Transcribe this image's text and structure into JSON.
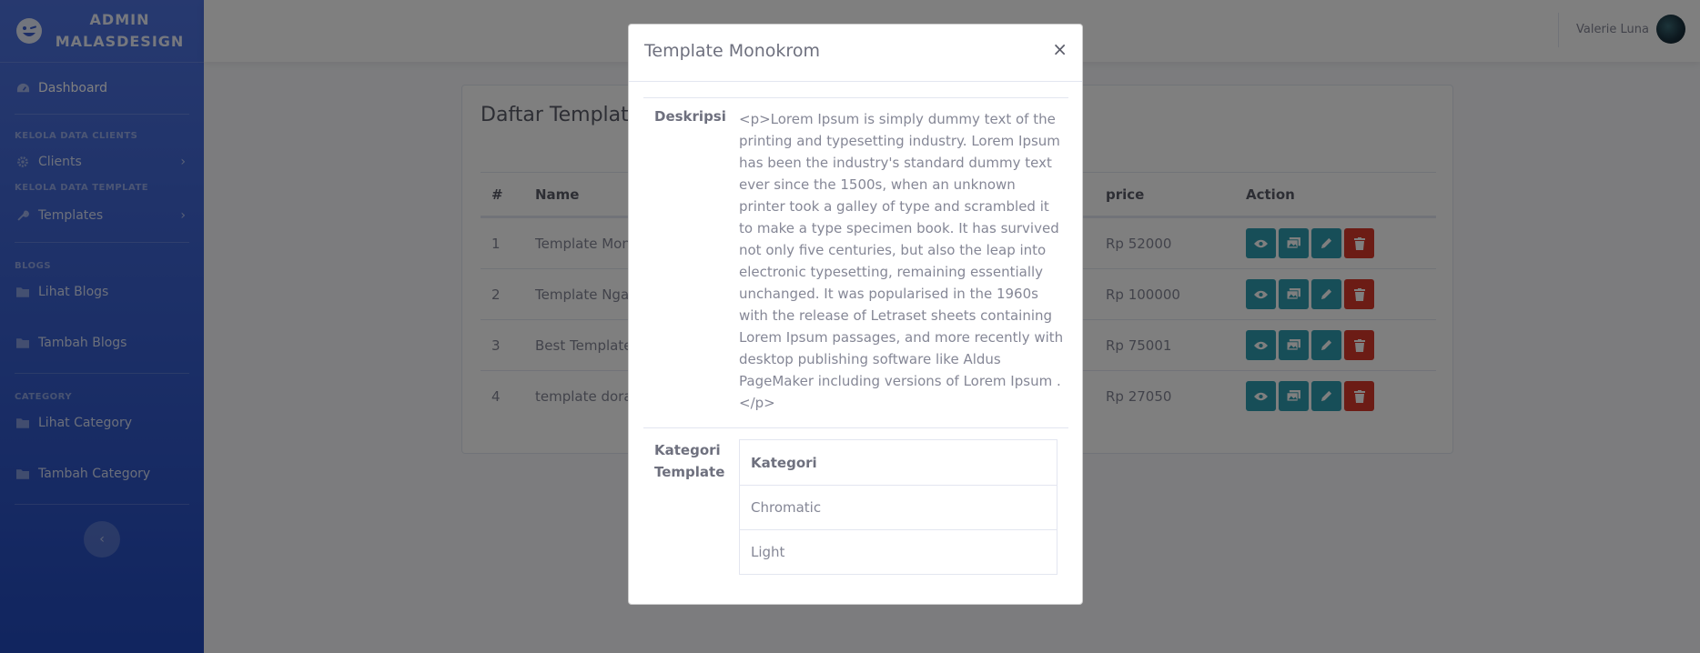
{
  "sidebar": {
    "brand_line1": "ADMIN",
    "brand_line2": "MALASDESIGN",
    "dashboard": "Dashboard",
    "sections": [
      {
        "heading": "KELOLA DATA CLIENTS",
        "items": [
          {
            "label": "Clients",
            "icon": "gear-icon",
            "has_arrow": true
          }
        ]
      },
      {
        "heading": "KELOLA DATA TEMPLATE",
        "items": [
          {
            "label": "Templates",
            "icon": "wrench-icon",
            "has_arrow": true
          }
        ]
      },
      {
        "heading": "BLOGS",
        "items": [
          {
            "label": "Lihat Blogs",
            "icon": "folder-icon"
          },
          {
            "label": "Tambah Blogs",
            "icon": "folder-icon"
          }
        ]
      },
      {
        "heading": "CATEGORY",
        "items": [
          {
            "label": "Lihat Category",
            "icon": "folder-icon"
          },
          {
            "label": "Tambah Category",
            "icon": "folder-icon"
          }
        ]
      }
    ]
  },
  "topbar": {
    "user_name": "Valerie Luna"
  },
  "content": {
    "title": "Daftar Template",
    "columns": [
      "#",
      "Name",
      "price",
      "Action"
    ],
    "rows": [
      {
        "no": "1",
        "name": "Template Monokrom",
        "price": "Rp 52000"
      },
      {
        "no": "2",
        "name": "Template Ngan",
        "price": "Rp 100000"
      },
      {
        "no": "3",
        "name": "Best Template",
        "price": "Rp 75001"
      },
      {
        "no": "4",
        "name": "template dorae",
        "price": "Rp 27050"
      }
    ]
  },
  "modal": {
    "title": "Template Monokrom",
    "close": "×",
    "desc_label": "Deskripsi",
    "description": "<p>Lorem Ipsum is simply dummy text of the printing and typesetting industry. Lorem Ipsum has been the industry's standard dummy text ever since the 1500s, when an unknown printer took a galley of type and scrambled it to make a type specimen book. It has survived not only five centuries, but also the leap into electronic typesetting, remaining essentially unchanged. It was popularised in the 1960s with the release of Letraset sheets containing Lorem Ipsum passages, and more recently with desktop publishing software like Aldus PageMaker including versions of Lorem Ipsum .</p>",
    "kategori_label_line1": "Kategori",
    "kategori_label_line2": "Template",
    "kategori_header": "Kategori",
    "kategori_items": [
      "Chromatic",
      "Light"
    ]
  },
  "colors": {
    "sidebar_top": "#4e73df",
    "sidebar_bottom": "#224abe",
    "btn_info": "#2e9cb0",
    "btn_danger": "#d8382b"
  }
}
